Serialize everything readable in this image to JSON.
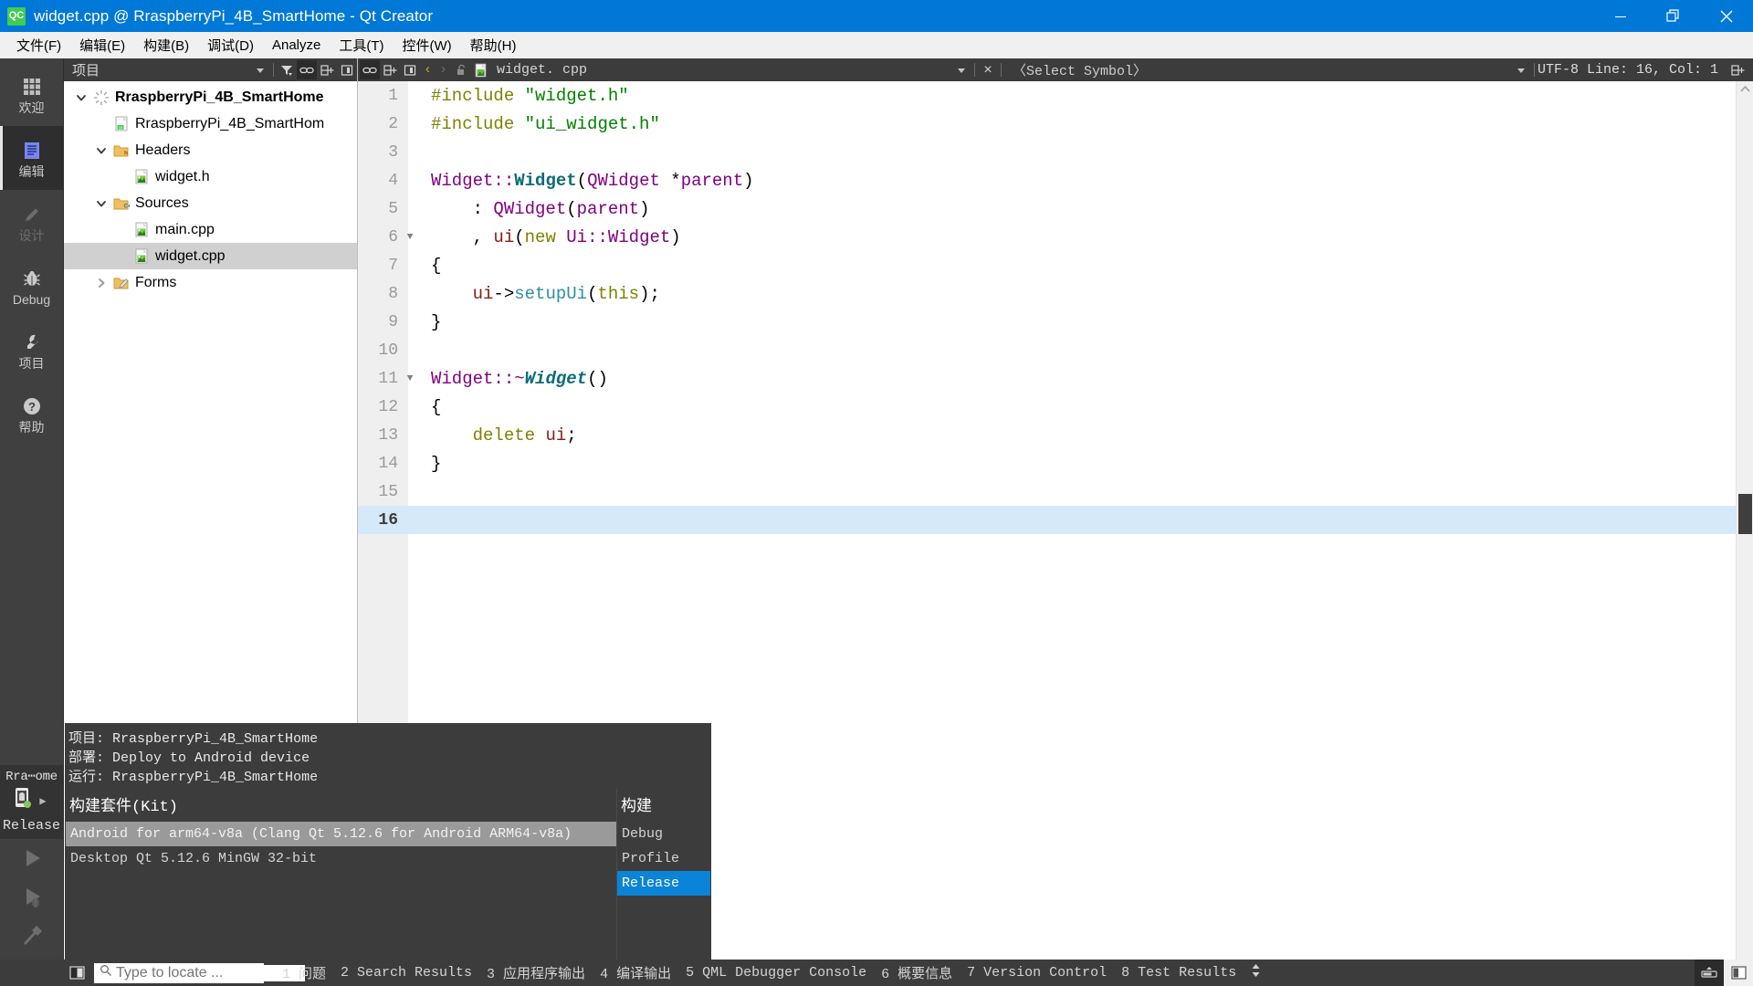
{
  "window": {
    "title": "widget.cpp @ RraspberryPi_4B_SmartHome - Qt Creator",
    "app_icon": "qt-creator-icon",
    "accent_color": "#0078d7",
    "controls": {
      "minimize": "minimize",
      "restore": "restore",
      "close": "close"
    }
  },
  "menubar": [
    {
      "label": "文件(F)",
      "name": "menu-file"
    },
    {
      "label": "编辑(E)",
      "name": "menu-edit"
    },
    {
      "label": "构建(B)",
      "name": "menu-build"
    },
    {
      "label": "调试(D)",
      "name": "menu-debug"
    },
    {
      "label": "Analyze",
      "name": "menu-analyze"
    },
    {
      "label": "工具(T)",
      "name": "menu-tools"
    },
    {
      "label": "控件(W)",
      "name": "menu-window"
    },
    {
      "label": "帮助(H)",
      "name": "menu-help"
    }
  ],
  "modebar": {
    "modes": [
      {
        "label": "欢迎",
        "icon": "grid-icon",
        "state": "normal"
      },
      {
        "label": "编辑",
        "icon": "document-icon",
        "state": "active"
      },
      {
        "label": "设计",
        "icon": "pencil-icon",
        "state": "disabled"
      },
      {
        "label": "Debug",
        "icon": "bug-icon",
        "state": "normal"
      },
      {
        "label": "项目",
        "icon": "wrench-icon",
        "state": "normal"
      },
      {
        "label": "帮助",
        "icon": "question-icon",
        "state": "normal"
      }
    ],
    "kit_selector": {
      "project": "Rra⋯ome",
      "device_icon": "android-device-icon",
      "status_dot_color": "#8ec460",
      "build_config": "Release",
      "expand_arrow": "chevron-right-icon"
    },
    "run_buttons": [
      {
        "name": "run-button",
        "icon": "play-icon"
      },
      {
        "name": "debug-button",
        "icon": "play-bug-icon"
      },
      {
        "name": "build-button",
        "icon": "hammer-icon"
      }
    ]
  },
  "project_panel": {
    "title": "项目",
    "header_icons": [
      {
        "name": "view-selector-chevron-icon",
        "state": "normal"
      },
      {
        "name": "filter-icon",
        "state": "normal"
      },
      {
        "name": "link-sync-icon",
        "state": "active"
      },
      {
        "name": "split-icon",
        "state": "normal"
      },
      {
        "name": "close-sidebar-icon",
        "state": "normal"
      }
    ],
    "tree": [
      {
        "label": "RraspberryPi_4B_SmartHome",
        "icon": "project-spinner-icon",
        "indent": 0,
        "arrow": "down",
        "bold": true,
        "selected": false
      },
      {
        "label": "RraspberryPi_4B_SmartHom",
        "icon": "qt-pro-file-icon",
        "indent": 1,
        "arrow": "none",
        "bold": false,
        "selected": false
      },
      {
        "label": "Headers",
        "icon": "folder-h-icon",
        "indent": 1,
        "arrow": "down",
        "bold": false,
        "selected": false
      },
      {
        "label": "widget.h",
        "icon": "cpp-file-icon",
        "indent": 2,
        "arrow": "none",
        "bold": false,
        "selected": false
      },
      {
        "label": "Sources",
        "icon": "folder-cpp-icon",
        "indent": 1,
        "arrow": "down",
        "bold": false,
        "selected": false
      },
      {
        "label": "main.cpp",
        "icon": "cpp-file-icon",
        "indent": 2,
        "arrow": "none",
        "bold": false,
        "selected": false
      },
      {
        "label": "widget.cpp",
        "icon": "cpp-file-icon",
        "indent": 2,
        "arrow": "none",
        "bold": false,
        "selected": true
      },
      {
        "label": "Forms",
        "icon": "folder-forms-icon",
        "indent": 1,
        "arrow": "right",
        "bold": false,
        "selected": false
      }
    ]
  },
  "editor_toolbar": {
    "icons_left": [
      {
        "name": "link-sync-icon",
        "state": "active"
      },
      {
        "name": "split-icon",
        "state": "normal"
      },
      {
        "name": "close-split-icon",
        "state": "normal"
      }
    ],
    "nav_back": "‹",
    "nav_forward": "›",
    "lock_icon": "unlocked-icon",
    "file_icon": "cpp-file-icon",
    "filename": "widget. cpp",
    "dropdown_icon": "chevron-down-icon",
    "close_icon": "×",
    "symbol_selector": "〈Select Symbol〉",
    "right_dropdown_icon": "chevron-down-icon",
    "encoding_and_position": "UTF-8 Line: 16, Col: 1",
    "split_icon": "split-icon"
  },
  "code": {
    "current_line": 16,
    "lines": [
      {
        "n": 1,
        "fold": "",
        "tokens": [
          {
            "t": "#include ",
            "c": "k-pre"
          },
          {
            "t": "\"widget.h\"",
            "c": "k-str"
          }
        ]
      },
      {
        "n": 2,
        "fold": "",
        "tokens": [
          {
            "t": "#include ",
            "c": "k-pre"
          },
          {
            "t": "\"ui_widget.h\"",
            "c": "k-str"
          }
        ]
      },
      {
        "n": 3,
        "fold": "",
        "tokens": []
      },
      {
        "n": 4,
        "fold": "",
        "tokens": [
          {
            "t": "Widget",
            "c": "k-type"
          },
          {
            "t": "::",
            "c": "k-type"
          },
          {
            "t": "Widget",
            "c": "k-fn"
          },
          {
            "t": "(",
            "c": "k-op"
          },
          {
            "t": "QWidget",
            "c": "k-type"
          },
          {
            "t": " *",
            "c": "k-op"
          },
          {
            "t": "parent",
            "c": "k-type"
          },
          {
            "t": ")",
            "c": "k-op"
          }
        ]
      },
      {
        "n": 5,
        "fold": "",
        "tokens": [
          {
            "t": "    : ",
            "c": "k-op"
          },
          {
            "t": "QWidget",
            "c": "k-type"
          },
          {
            "t": "(",
            "c": "k-op"
          },
          {
            "t": "parent",
            "c": "k-type"
          },
          {
            "t": ")",
            "c": "k-op"
          }
        ]
      },
      {
        "n": 6,
        "fold": "▼",
        "tokens": [
          {
            "t": "    , ",
            "c": "k-op"
          },
          {
            "t": "ui",
            "c": "k-var"
          },
          {
            "t": "(",
            "c": "k-op"
          },
          {
            "t": "new ",
            "c": "k-kw"
          },
          {
            "t": "Ui",
            "c": "k-type"
          },
          {
            "t": "::",
            "c": "k-type"
          },
          {
            "t": "Widget",
            "c": "k-type"
          },
          {
            "t": ")",
            "c": "k-op"
          }
        ]
      },
      {
        "n": 7,
        "fold": "",
        "tokens": [
          {
            "t": "{",
            "c": "k-op"
          }
        ]
      },
      {
        "n": 8,
        "fold": "",
        "tokens": [
          {
            "t": "    ",
            "c": "k-op"
          },
          {
            "t": "ui",
            "c": "k-var"
          },
          {
            "t": "->",
            "c": "k-op"
          },
          {
            "t": "setupUi",
            "c": "k-call"
          },
          {
            "t": "(",
            "c": "k-op"
          },
          {
            "t": "this",
            "c": "k-kw"
          },
          {
            "t": ");",
            "c": "k-op"
          }
        ]
      },
      {
        "n": 9,
        "fold": "",
        "tokens": [
          {
            "t": "}",
            "c": "k-op"
          }
        ]
      },
      {
        "n": 10,
        "fold": "",
        "tokens": []
      },
      {
        "n": 11,
        "fold": "▼",
        "tokens": [
          {
            "t": "Widget",
            "c": "k-type"
          },
          {
            "t": "::~",
            "c": "k-type"
          },
          {
            "t": "Widget",
            "c": "k-fnd"
          },
          {
            "t": "()",
            "c": "k-op"
          }
        ]
      },
      {
        "n": 12,
        "fold": "",
        "tokens": [
          {
            "t": "{",
            "c": "k-op"
          }
        ]
      },
      {
        "n": 13,
        "fold": "",
        "tokens": [
          {
            "t": "    ",
            "c": "k-op"
          },
          {
            "t": "delete ",
            "c": "k-kw"
          },
          {
            "t": "ui",
            "c": "k-var"
          },
          {
            "t": ";",
            "c": "k-op"
          }
        ]
      },
      {
        "n": 14,
        "fold": "",
        "tokens": [
          {
            "t": "}",
            "c": "k-op"
          }
        ]
      },
      {
        "n": 15,
        "fold": "",
        "tokens": []
      },
      {
        "n": 16,
        "fold": "",
        "tokens": []
      }
    ]
  },
  "popup": {
    "info": [
      {
        "label": "项目:",
        "value": "RraspberryPi_4B_SmartHome"
      },
      {
        "label": "部署:",
        "value": "Deploy to Android device"
      },
      {
        "label": "运行:",
        "value": "RraspberryPi_4B_SmartHome"
      }
    ],
    "kit_column_title": "构建套件(Kit)",
    "build_column_title": "构建",
    "kits": [
      {
        "label": "Android for arm64-v8a (Clang Qt 5.12.6 for Android ARM64-v8a)",
        "selected": true
      },
      {
        "label": "Desktop Qt 5.12.6 MinGW 32-bit",
        "selected": false
      }
    ],
    "builds": [
      {
        "label": "Debug",
        "selected": false
      },
      {
        "label": "Profile",
        "selected": false
      },
      {
        "label": "Release",
        "selected": true
      }
    ],
    "selected_highlight_color": "#0a84d8"
  },
  "statusbar": {
    "toggle_icon": "toggle-sidebar-icon",
    "locator": {
      "icon": "search-icon",
      "placeholder": "Type to locate ...",
      "value": ""
    },
    "panes": [
      "1 问题",
      "2 Search Results",
      "3 应用程序输出",
      "4 编译输出",
      "5 QML Debugger Console",
      "6 概要信息",
      "7 Version Control",
      "8 Test Results"
    ],
    "updown_icon": "updown-arrows-icon",
    "right_icons": [
      {
        "name": "progress-details-icon",
        "state": "active"
      },
      {
        "name": "toggle-output-pane-icon",
        "state": "light"
      }
    ]
  }
}
